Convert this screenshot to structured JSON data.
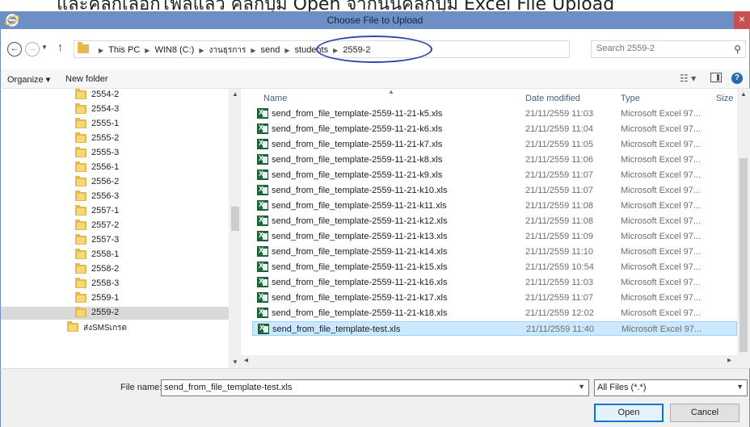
{
  "caption": "และคลิกเลือกไฟล์แล้ว คลิกปุ่ม Open จากนั้นคลิกปุ่ม Excel File Upload",
  "window": {
    "title": "Choose File to Upload",
    "close_label": "×"
  },
  "navigation": {
    "breadcrumb": [
      "This PC",
      "WIN8 (C:)",
      "งานธุรการ",
      "send",
      "students",
      "2559-2"
    ],
    "search_placeholder": "Search 2559-2"
  },
  "toolbar": {
    "organize_label": "Organize ▾",
    "new_folder_label": "New folder"
  },
  "folder_tree": {
    "items": [
      "2554-2",
      "2554-3",
      "2555-1",
      "2555-2",
      "2555-3",
      "2556-1",
      "2556-2",
      "2556-3",
      "2557-1",
      "2557-2",
      "2557-3",
      "2558-1",
      "2558-2",
      "2558-3",
      "2559-1",
      "2559-2",
      "ส่งSMSเกรด"
    ],
    "selected": "2559-2"
  },
  "file_list": {
    "columns": [
      "Name",
      "Date modified",
      "Type",
      "Size"
    ],
    "files": [
      {
        "name": "send_from_file_template-2559-11-21-k5.xls",
        "date": "21/11/2559 11:03",
        "type": "Microsoft Excel 97..."
      },
      {
        "name": "send_from_file_template-2559-11-21-k6.xls",
        "date": "21/11/2559 11:04",
        "type": "Microsoft Excel 97..."
      },
      {
        "name": "send_from_file_template-2559-11-21-k7.xls",
        "date": "21/11/2559 11:05",
        "type": "Microsoft Excel 97..."
      },
      {
        "name": "send_from_file_template-2559-11-21-k8.xls",
        "date": "21/11/2559 11:06",
        "type": "Microsoft Excel 97..."
      },
      {
        "name": "send_from_file_template-2559-11-21-k9.xls",
        "date": "21/11/2559 11:07",
        "type": "Microsoft Excel 97..."
      },
      {
        "name": "send_from_file_template-2559-11-21-k10.xls",
        "date": "21/11/2559 11:07",
        "type": "Microsoft Excel 97..."
      },
      {
        "name": "send_from_file_template-2559-11-21-k11.xls",
        "date": "21/11/2559 11:08",
        "type": "Microsoft Excel 97..."
      },
      {
        "name": "send_from_file_template-2559-11-21-k12.xls",
        "date": "21/11/2559 11:08",
        "type": "Microsoft Excel 97..."
      },
      {
        "name": "send_from_file_template-2559-11-21-k13.xls",
        "date": "21/11/2559 11:09",
        "type": "Microsoft Excel 97..."
      },
      {
        "name": "send_from_file_template-2559-11-21-k14.xls",
        "date": "21/11/2559 11:10",
        "type": "Microsoft Excel 97..."
      },
      {
        "name": "send_from_file_template-2559-11-21-k15.xls",
        "date": "21/11/2559 10:54",
        "type": "Microsoft Excel 97..."
      },
      {
        "name": "send_from_file_template-2559-11-21-k16.xls",
        "date": "21/11/2559 11:03",
        "type": "Microsoft Excel 97..."
      },
      {
        "name": "send_from_file_template-2559-11-21-k17.xls",
        "date": "21/11/2559 11:07",
        "type": "Microsoft Excel 97..."
      },
      {
        "name": "send_from_file_template-2559-11-21-k18.xls",
        "date": "21/11/2559 12:02",
        "type": "Microsoft Excel 97..."
      },
      {
        "name": "send_from_file_template-test.xls",
        "date": "21/11/2559 11:40",
        "type": "Microsoft Excel 97..."
      }
    ],
    "selected": "send_from_file_template-test.xls"
  },
  "footer": {
    "file_name_label": "File name:",
    "file_name_value": "send_from_file_template-test.xls",
    "file_type_value": "All Files (*.*)",
    "open_label": "Open",
    "cancel_label": "Cancel"
  },
  "colors": {
    "titlebar": "#6c90c6",
    "close": "#c75050",
    "selection": "#cce8ff",
    "annotation": "#3346b0"
  }
}
